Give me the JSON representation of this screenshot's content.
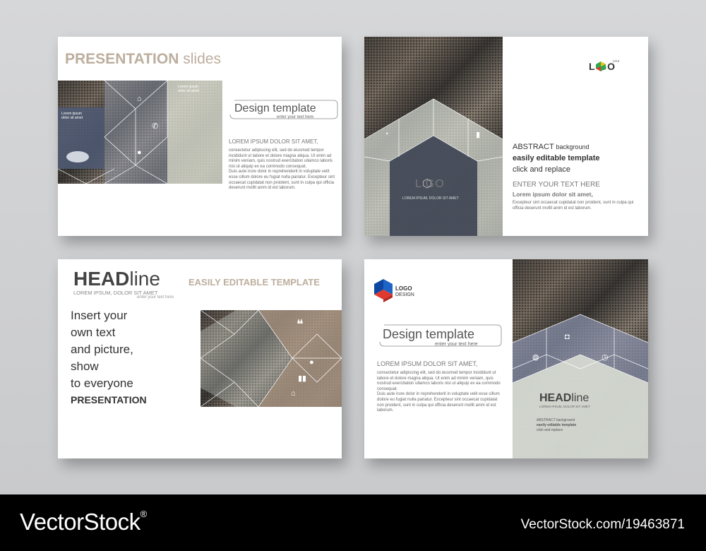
{
  "slide1": {
    "title_bold": "PRESENTATION",
    "title_light": "slides",
    "panel_heading": "Lorem ipsum\ndolor sit amet",
    "design_template": "Design template",
    "enter_text": "enter your text here",
    "lorem_heading": "LOREM IPSUM DOLOR SIT AMET,",
    "lorem_body": "consectetur adipiscing elit, sed do eiusmod tempor incididunt ut labore et dolore magna aliqua. Ut enim ad minim veniam, quis nostrud exercitation ullamco laboris nisi ut aliquip ex ea commodo consequat.\nDuis aute irure dolor in reprehenderit in voluptate velit esse cillum dolore eu fugiat nulla pariatur. Excepteur sint occaecat cupidatat non proident, sunt in culpa qui officia deserunt mollit anim id est laborum."
  },
  "slide2": {
    "logo_your": "your",
    "logo_text": "L GO",
    "center_logo": "L GO",
    "center_caption": "LOREM IPSUM, DOLOR SIT AMET",
    "abstract": "ABSTRACT",
    "background": "background",
    "easily": "easily editable template",
    "click": "click and replace",
    "enter_caps": "ENTER YOUR TEXT HERE",
    "lorem_short": "Lorem ipsum dolor sit amet,",
    "lorem_body": "Excepteur sint occaecat cupidatat non proident, sunt in culpa qui officia deserunt mollit anim id est laborum."
  },
  "slide3": {
    "head_bold": "HEAD",
    "head_light": "line",
    "easily": "EASILY EDITABLE TEMPLATE",
    "sub": "LOREM IPSUM, DOLOR SIT AMET",
    "sub2": "enter your text here",
    "insert_lines": [
      "Insert your",
      "own text",
      "and picture,",
      "show",
      "to everyone"
    ],
    "presentation": "PRESENTATION"
  },
  "slide4": {
    "logo_line1": "LOGO",
    "logo_line2": "DESIGN",
    "design_template": "Design template",
    "enter_text": "enter your text here",
    "lorem_heading": "LOREM IPSUM DOLOR SIT AMET,",
    "lorem_body": "consectetur adipiscing elit, sed do eiusmod tempor incididunt ut labore et dolore magna aliqua. Ut enim ad minim veniam, quis nostrud exercitation ullamco laboris nisi ut aliquip ex ea commodo consequat.\nDuis aute irure dolor in reprehenderit in voluptate velit esse cillum dolore eu fugiat nulla pariatur. Excepteur sint occaecat cupidatat non proident, sunt in culpa qui officia deserunt mollit anim id est laborum.",
    "head_bold": "HEAD",
    "head_light": "line",
    "head_sub": "LOREM IPSUM, DOLOR SIT AMET",
    "abstract_small": "ABSTRACT background",
    "easily_small": "easily editable template",
    "click_small": "click and replace"
  },
  "footer": {
    "brand": "VectorStock",
    "reg": "®",
    "id": "VectorStock.com/19463871"
  },
  "colors": {
    "accent_green": "#2fa84f",
    "accent_red": "#e03a2f",
    "accent_yellow": "#f2c018",
    "logo_blue": "#1e63c6",
    "title_beige": "#b9ab9a"
  }
}
